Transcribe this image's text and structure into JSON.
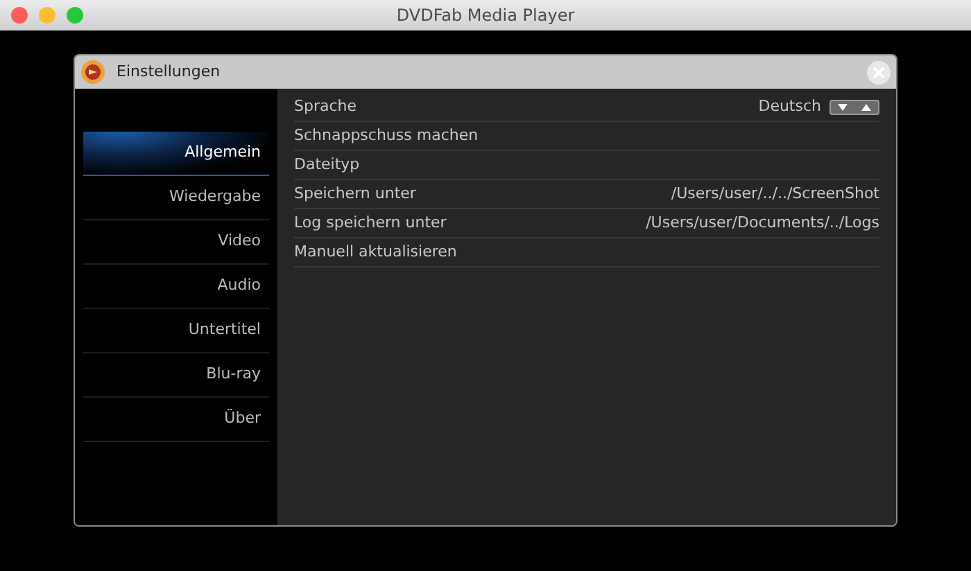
{
  "window": {
    "title": "DVDFab Media Player"
  },
  "dialog": {
    "title": "Einstellungen"
  },
  "sidebar": {
    "items": [
      {
        "label": "Allgemein",
        "selected": true
      },
      {
        "label": "Wiedergabe",
        "selected": false
      },
      {
        "label": "Video",
        "selected": false
      },
      {
        "label": "Audio",
        "selected": false
      },
      {
        "label": "Untertitel",
        "selected": false
      },
      {
        "label": "Blu-ray",
        "selected": false
      },
      {
        "label": "Über",
        "selected": false
      }
    ]
  },
  "settings": [
    {
      "label": "Sprache",
      "kind": "spinner",
      "value": "Deutsch"
    },
    {
      "label": "Schnappschuss machen",
      "kind": "plain"
    },
    {
      "label": "Dateityp",
      "kind": "plain"
    },
    {
      "label": "Speichern unter",
      "kind": "path",
      "value": "/Users/user/../../ScreenShot"
    },
    {
      "label": "Log speichern unter",
      "kind": "path",
      "value": "/Users/user/Documents/../Logs"
    },
    {
      "label": "Manuell aktualisieren",
      "kind": "plain"
    }
  ]
}
